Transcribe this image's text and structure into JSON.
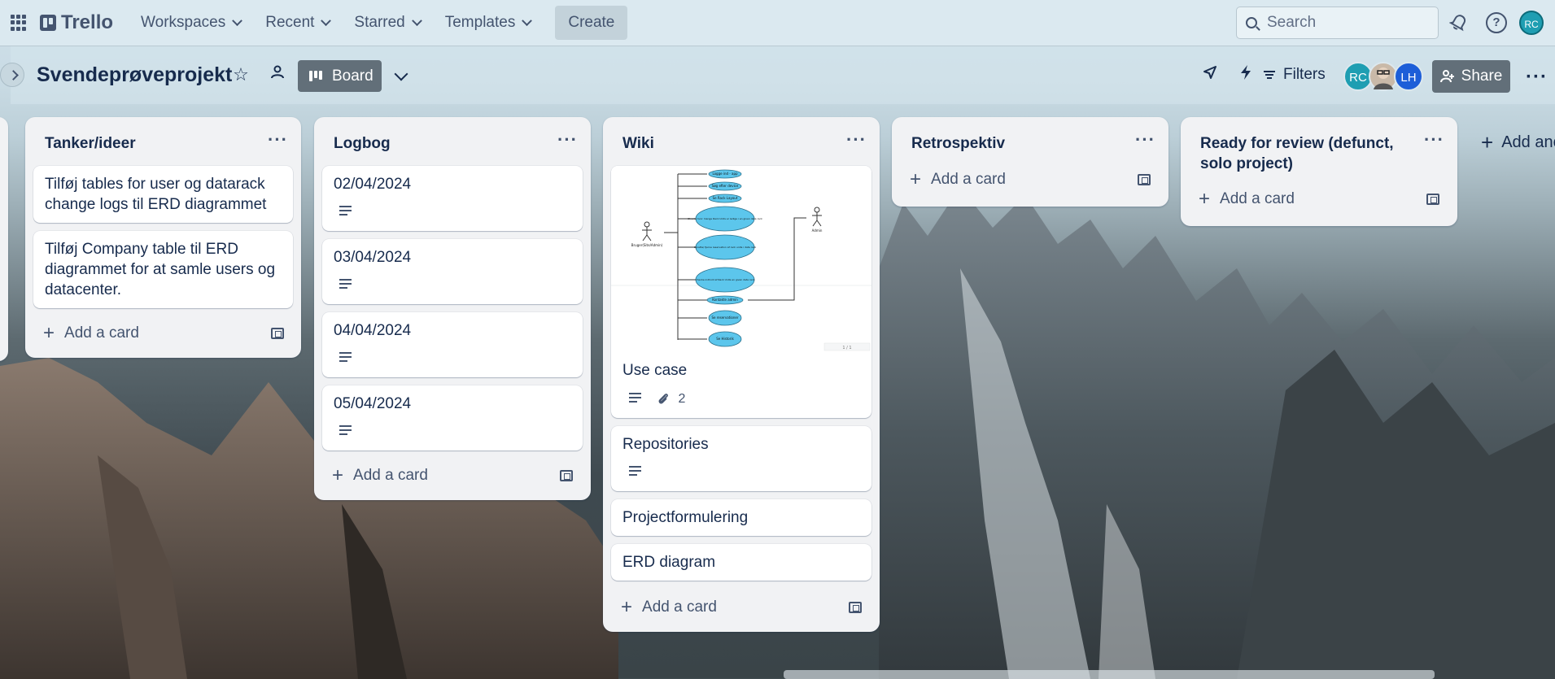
{
  "topbar": {
    "logo": "Trello",
    "nav": [
      "Workspaces",
      "Recent",
      "Starred",
      "Templates"
    ],
    "create_label": "Create",
    "search_placeholder": "Search",
    "user_initials": "RC"
  },
  "board": {
    "title": "Svendeprøveprojekt",
    "view_label": "Board",
    "filters_label": "Filters",
    "share_label": "Share",
    "members": [
      {
        "initials": "RC",
        "color": "#1f9eb2"
      },
      {
        "initials": "",
        "color": "#c9b9a8"
      },
      {
        "initials": "LH",
        "color": "#1d5ed8"
      }
    ]
  },
  "lists": [
    {
      "title": "Tanker/ideer",
      "cards": [
        {
          "title": "Tilføj tables for user og datarack change logs til ERD diagrammet"
        },
        {
          "title": "Tilføj Company table til ERD diagrammet for at samle users og datacenter."
        }
      ],
      "add_label": "Add a card"
    },
    {
      "title": "Logbog",
      "cards": [
        {
          "title": "02/04/2024",
          "has_description": true
        },
        {
          "title": "03/04/2024",
          "has_description": true
        },
        {
          "title": "04/04/2024",
          "has_description": true
        },
        {
          "title": "05/04/2024",
          "has_description": true
        }
      ],
      "add_label": "Add a card"
    },
    {
      "title": "Wiki",
      "cards": [
        {
          "title": "Use case",
          "has_description": true,
          "attachments": "2",
          "has_cover": true
        },
        {
          "title": "Repositories",
          "has_description": true
        },
        {
          "title": "Projectformulering"
        },
        {
          "title": "ERD diagram"
        }
      ],
      "add_label": "Add a card"
    },
    {
      "title": "Retrospektiv",
      "cards": [],
      "add_label": "Add a card"
    },
    {
      "title": "Ready for review (defunct, solo project)",
      "cards": [],
      "add_label": "Add a card"
    }
  ],
  "add_list_label": "Add another list",
  "usecase_diagram": {
    "actors": [
      "Bruger(Site/Admin)",
      "Admin"
    ],
    "cases": [
      "Logge ind - app",
      "Søg efter device",
      "Se Rack Layout",
      "Checke hvor mange Rack Units er ledige i en given data rack",
      "Oprette/ fjerne reservation af rack units i data rack",
      "Checke indhold af Rack Units en given data rack",
      "Kontakte admin",
      "Se reservationer",
      "Se Historik"
    ],
    "pager": "1 / 1"
  }
}
